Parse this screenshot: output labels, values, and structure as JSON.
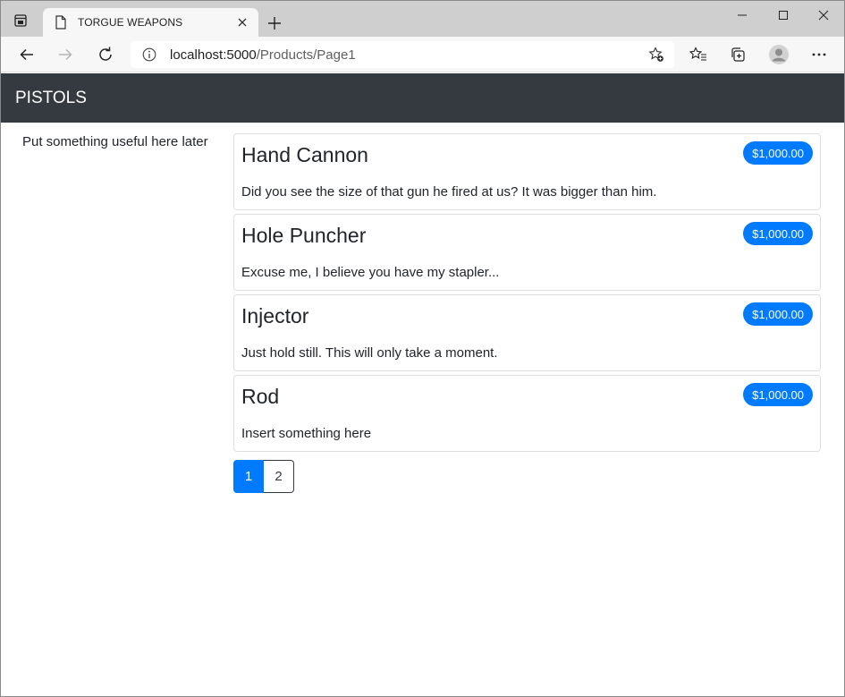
{
  "browser": {
    "tab_title": "TORGUE WEAPONS",
    "url_host": "localhost:5000",
    "url_path": "/Products/Page1"
  },
  "navbar": {
    "brand": "PISTOLS"
  },
  "sidebar": {
    "text": "Put something useful here later"
  },
  "products": [
    {
      "name": "Hand Cannon",
      "price": "$1,000.00",
      "description": "Did you see the size of that gun he fired at us? It was bigger than him."
    },
    {
      "name": "Hole Puncher",
      "price": "$1,000.00",
      "description": "Excuse me, I believe you have my stapler..."
    },
    {
      "name": "Injector",
      "price": "$1,000.00",
      "description": "Just hold still. This will only take a moment."
    },
    {
      "name": "Rod",
      "price": "$1,000.00",
      "description": "Insert something here"
    }
  ],
  "pagination": {
    "pages": [
      "1",
      "2"
    ],
    "current": "1"
  },
  "colors": {
    "navbar_bg": "#343a40",
    "primary": "#007bff"
  },
  "icons": {
    "tab_actions": "tab-actions-icon",
    "page": "page-icon",
    "close": "close-icon",
    "new_tab": "plus-icon",
    "back": "back-arrow-icon",
    "forward": "forward-arrow-icon",
    "refresh": "refresh-icon",
    "info": "info-icon",
    "add_favorite": "star-plus-icon",
    "favorites": "favorites-icon",
    "collections": "collections-icon",
    "profile": "profile-avatar-icon",
    "more": "more-menu-icon"
  }
}
